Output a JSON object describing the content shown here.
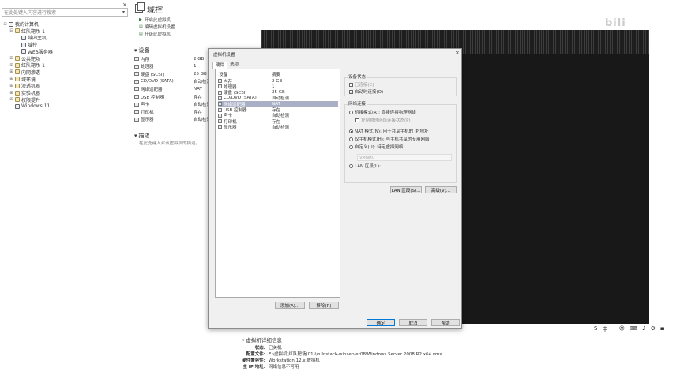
{
  "library": {
    "search_placeholder": "在此处键入内容进行搜索",
    "close_glyph": "×",
    "tree": [
      {
        "label": "我的计算机",
        "level": 0,
        "toggle": "⊟",
        "icon": "computer"
      },
      {
        "label": "红队靶场-1",
        "level": 1,
        "toggle": "⊟",
        "icon": "folder"
      },
      {
        "label": "域内主机",
        "level": 2,
        "toggle": "",
        "icon": "vm"
      },
      {
        "label": "域控",
        "level": 2,
        "toggle": "",
        "icon": "vm"
      },
      {
        "label": "WEB服务器",
        "level": 2,
        "toggle": "",
        "icon": "vm"
      },
      {
        "label": "公共靶场",
        "level": 1,
        "toggle": "⊞",
        "icon": "folder"
      },
      {
        "label": "红队靶场-1",
        "level": 1,
        "toggle": "⊞",
        "icon": "folder"
      },
      {
        "label": "内网渗透",
        "level": 1,
        "toggle": "⊞",
        "icon": "folder"
      },
      {
        "label": "域环境",
        "level": 1,
        "toggle": "⊞",
        "icon": "folder"
      },
      {
        "label": "渗透机器",
        "level": 1,
        "toggle": "⊞",
        "icon": "folder"
      },
      {
        "label": "实验机器",
        "level": 1,
        "toggle": "⊞",
        "icon": "folder"
      },
      {
        "label": "权限提升",
        "level": 1,
        "toggle": "⊞",
        "icon": "folder"
      },
      {
        "label": "Windows 11",
        "level": 1,
        "toggle": "",
        "icon": "vm"
      }
    ]
  },
  "main": {
    "tab_title": "域控",
    "commands": [
      "开启此虚拟机",
      "编辑虚拟机设置",
      "升级此虚拟机"
    ],
    "devices_title": "设备",
    "devices": [
      {
        "name": "内存",
        "value": "2 GB"
      },
      {
        "name": "处理器",
        "value": "1"
      },
      {
        "name": "硬盘 (SCSI)",
        "value": "25 GB"
      },
      {
        "name": "CD/DVD (SATA)",
        "value": "自动检测"
      },
      {
        "name": "网络适配器",
        "value": "NAT"
      },
      {
        "name": "USB 控制器",
        "value": "存在"
      },
      {
        "name": "声卡",
        "value": "自动检测"
      },
      {
        "name": "打印机",
        "value": "存在"
      },
      {
        "name": "显示器",
        "value": "自动检测"
      }
    ],
    "description_title": "描述",
    "description_text": "在此处键入对该虚拟机的描述。",
    "watermark": "bili",
    "details_title": "虚拟机详细信息",
    "details": [
      {
        "key": "状态:",
        "value": "已关机"
      },
      {
        "key": "配置文件:",
        "value": "E:\\虚拟机\\红队靶场(01)\\vulnstack-winserver08\\Windows Server 2008 R2 x64.vmx"
      },
      {
        "key": "硬件兼容性:",
        "value": "Workstation 12.x 虚拟机"
      },
      {
        "key": "主 IP 地址:",
        "value": "网络信息不可用"
      }
    ],
    "tray": [
      "S",
      "中",
      "·",
      "☺",
      "⌨",
      "♪",
      "⚙",
      "▪"
    ]
  },
  "dialog": {
    "title": "虚拟机设置",
    "close": "×",
    "tabs": [
      "硬件",
      "选项"
    ],
    "col_device": "设备",
    "col_summary": "摘要",
    "hardware": [
      {
        "name": "内存",
        "summary": "2 GB"
      },
      {
        "name": "处理器",
        "summary": "1"
      },
      {
        "name": "硬盘 (SCSI)",
        "summary": "25 GB"
      },
      {
        "name": "CD/DVD (SATA)",
        "summary": "自动检测"
      },
      {
        "name": "网络适配器",
        "summary": "NAT"
      },
      {
        "name": "USB 控制器",
        "summary": "存在"
      },
      {
        "name": "声卡",
        "summary": "自动检测"
      },
      {
        "name": "打印机",
        "summary": "存在"
      },
      {
        "name": "显示器",
        "summary": "自动检测"
      }
    ],
    "selected_index": 4,
    "add_button": "添加(A)...",
    "remove_button": "移除(R)",
    "device_status_title": "设备状态",
    "connected_label": "已连接(C)",
    "connect_on_power_label": "启动时连接(O)",
    "network_title": "网络连接",
    "bridged_label": "桥接模式(R): 直接连接物理网络",
    "replicate_label": "复制物理网络连接状态(P)",
    "nat_label": "NAT 模式(N): 用于共享主机的 IP 地址",
    "hostonly_label": "仅主机模式(H): 与主机共享的专用网络",
    "custom_label": "自定义(U): 特定虚拟网络",
    "vmnet_value": "VMnet0",
    "lan_label": "LAN 区段(L):",
    "lan_segments_button": "LAN 区段(S)...",
    "advanced_button": "高级(V)...",
    "ok_button": "确定",
    "cancel_button": "取消",
    "help_button": "帮助"
  }
}
